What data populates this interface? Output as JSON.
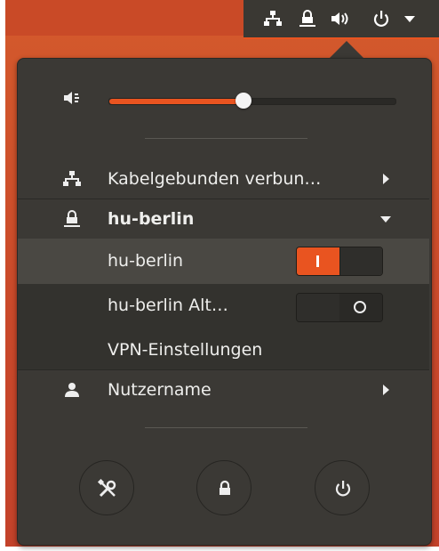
{
  "panel": {
    "tray_icons": [
      "network-wired-icon",
      "vpn-lock-icon",
      "volume-icon",
      "power-icon",
      "chevron-down-icon"
    ]
  },
  "volume": {
    "level": 0.47,
    "icon": "volume-low-icon"
  },
  "menu": {
    "wired_label": "Kabelgebunden verbun…",
    "vpn_header_label": "hu-berlin",
    "vpn_items": [
      {
        "label": "hu-berlin",
        "enabled": true
      },
      {
        "label": "hu-berlin Alt…",
        "enabled": false
      }
    ],
    "vpn_settings_label": "VPN-Einstellungen",
    "user_label": "Nutzername"
  },
  "buttons": {
    "settings": "tools-icon",
    "lock": "lock-icon",
    "power": "power-icon"
  },
  "colors": {
    "accent": "#e95420",
    "popover_bg": "#3b3935",
    "desktop_bg": "#d45a2c"
  }
}
